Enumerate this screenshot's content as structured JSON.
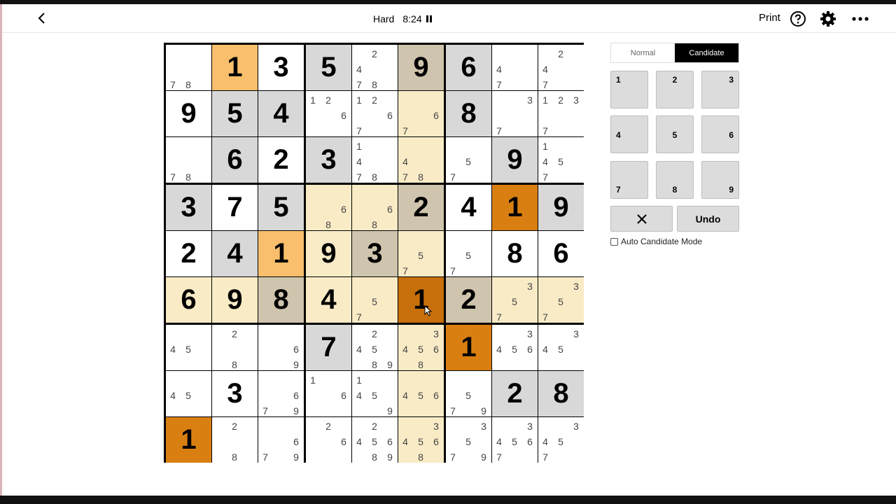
{
  "header": {
    "difficulty": "Hard",
    "timer": "8:24",
    "print_label": "Print"
  },
  "mode": {
    "normal_label": "Normal",
    "candidate_label": "Candidate",
    "active": "Candidate"
  },
  "keypad": [
    "1",
    "2",
    "3",
    "4",
    "5",
    "6",
    "7",
    "8",
    "9"
  ],
  "actions": {
    "undo_label": "Undo",
    "erase_icon": "x-icon"
  },
  "auto_candidate_label": "Auto Candidate Mode",
  "colors": {
    "white": "#ffffff",
    "given_gray": "#d8d8d8",
    "beige": "#f9ebc6",
    "tan": "#cfc4ad",
    "light_orange": "#f9bf6c",
    "orange": "#d97f12",
    "dark_orange": "#c76f0a"
  },
  "board": {
    "values": [
      [
        "",
        "1",
        "3",
        "5",
        "",
        "9",
        "6",
        "",
        ""
      ],
      [
        "9",
        "5",
        "4",
        "",
        "",
        "",
        "8",
        "",
        ""
      ],
      [
        "",
        "6",
        "2",
        "3",
        "",
        "",
        "",
        "9",
        ""
      ],
      [
        "3",
        "7",
        "5",
        "",
        "",
        "2",
        "4",
        "1",
        "9"
      ],
      [
        "2",
        "4",
        "1",
        "9",
        "3",
        "",
        "",
        "8",
        "6"
      ],
      [
        "6",
        "9",
        "8",
        "4",
        "",
        "1",
        "2",
        "",
        ""
      ],
      [
        "",
        "",
        "",
        "7",
        "",
        "",
        "1",
        "",
        ""
      ],
      [
        "",
        "3",
        "",
        "",
        "",
        "",
        "",
        "2",
        "8"
      ],
      [
        "1",
        "",
        "",
        "",
        "",
        "",
        "",
        "",
        ""
      ]
    ],
    "candidates": [
      [
        "78",
        "",
        "",
        "",
        "2478",
        "",
        "",
        "47",
        "247"
      ],
      [
        "",
        "",
        "",
        "126",
        "1267",
        "67",
        "",
        "37",
        "1237"
      ],
      [
        "78",
        "",
        "",
        "",
        "1478",
        "478",
        "57",
        "",
        "1457"
      ],
      [
        "",
        "",
        "",
        "68",
        "68",
        "",
        "",
        "",
        ""
      ],
      [
        "",
        "",
        "",
        "",
        "",
        "57",
        "57",
        "",
        ""
      ],
      [
        "",
        "",
        "",
        "",
        "57",
        "",
        "",
        "357",
        "357"
      ],
      [
        "45",
        "28",
        "69",
        "",
        "24589",
        "34568",
        "",
        "3456",
        "345"
      ],
      [
        "45",
        "",
        "679",
        "16",
        "1459",
        "456",
        "579",
        "",
        ""
      ],
      [
        "",
        "28",
        "679",
        "26",
        "245689",
        "34568",
        "3579",
        "34567",
        "3457"
      ]
    ],
    "cell_colors": [
      [
        "white",
        "light_orange",
        "white",
        "given_gray",
        "white",
        "tan",
        "given_gray",
        "white",
        "white"
      ],
      [
        "white",
        "given_gray",
        "given_gray",
        "white",
        "white",
        "beige",
        "given_gray",
        "white",
        "white"
      ],
      [
        "white",
        "given_gray",
        "white",
        "given_gray",
        "white",
        "beige",
        "white",
        "given_gray",
        "white"
      ],
      [
        "given_gray",
        "white",
        "given_gray",
        "beige",
        "beige",
        "tan",
        "white",
        "orange",
        "given_gray"
      ],
      [
        "white",
        "given_gray",
        "light_orange",
        "beige",
        "tan",
        "beige",
        "white",
        "white",
        "white"
      ],
      [
        "beige",
        "beige",
        "tan",
        "beige",
        "beige",
        "dark_orange",
        "tan",
        "beige",
        "beige"
      ],
      [
        "white",
        "white",
        "white",
        "given_gray",
        "white",
        "beige",
        "orange",
        "white",
        "white"
      ],
      [
        "white",
        "white",
        "white",
        "white",
        "white",
        "beige",
        "white",
        "given_gray",
        "given_gray"
      ],
      [
        "orange",
        "white",
        "white",
        "white",
        "white",
        "beige",
        "white",
        "white",
        "white"
      ]
    ]
  }
}
